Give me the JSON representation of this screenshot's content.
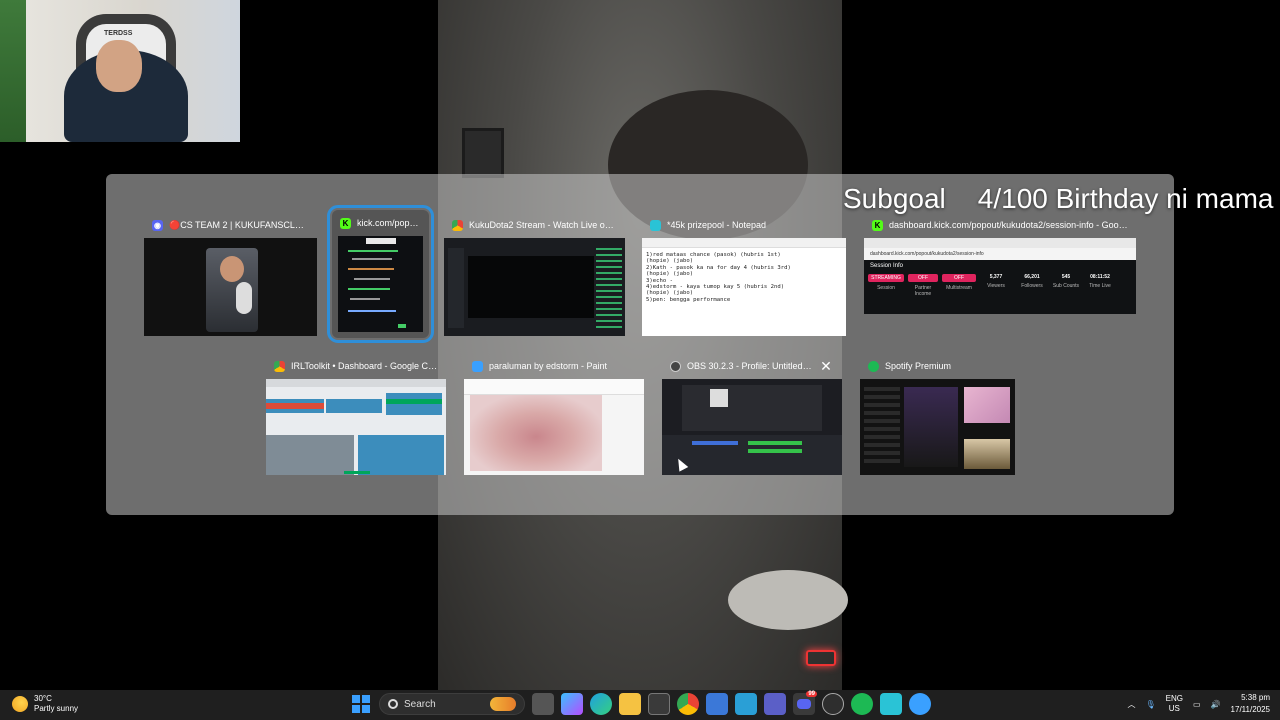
{
  "overlay": {
    "subgoal_label": "Subgoal",
    "subgoal_value": "4/100 Birthday ni mama",
    "chair_brand": "TERDSS"
  },
  "windows": [
    {
      "id": "discord",
      "title": "🔴CS TEAM 2 | KUKUFANSCLUB - Disco...",
      "icon": "discord-icon",
      "color": "#5865f2"
    },
    {
      "id": "kick-popout",
      "title": "kick.com/popo...",
      "icon": "kick-icon",
      "color": "#53fc18",
      "selected": true
    },
    {
      "id": "kukudota-stream",
      "title": "KukuDota2 Stream - Watch Live on Kick...",
      "icon": "chrome-icon",
      "color": "#4285f4"
    },
    {
      "id": "notepad",
      "title": "*45k prizepool - Notepad",
      "icon": "notepad-icon",
      "color": "#2ac3d6"
    },
    {
      "id": "session-info",
      "title": "dashboard.kick.com/popout/kukudota2/session-info - Google C...",
      "icon": "kick-icon",
      "color": "#53fc18"
    },
    {
      "id": "irltoolkit",
      "title": "IRLToolkit • Dashboard - Google Chrome",
      "icon": "chrome-icon",
      "color": "#4285f4"
    },
    {
      "id": "paint",
      "title": "paraluman by edstorm - Paint",
      "icon": "paint-icon",
      "color": "#3aa0ff"
    },
    {
      "id": "obs",
      "title": "OBS 30.2.3 - Profile: Untitled - Sce...",
      "icon": "obs-icon",
      "color": "#444"
    },
    {
      "id": "spotify",
      "title": "Spotify Premium",
      "icon": "spotify-icon",
      "color": "#1db954"
    }
  ],
  "notepad_lines": [
    "1)red mataas chance (pasok) (hubris 1st)",
    "(hopie) (jabo)",
    "2)Kath - pasok ka na for day 4 (hubris 3rd)",
    "(hopie) (jabo)",
    "3)echo -",
    "4)edstorm - kaya tumop kay 5 (hubris 2nd)",
    "(hopie) (jabo)",
    "5)pen: bengga performance"
  ],
  "session_info": {
    "url": "dashboard.kick.com/popout/kukudota2/session-info",
    "heading": "Session Info",
    "stats": [
      {
        "badge": "STREAMING",
        "label": "Session"
      },
      {
        "badge": "OFF",
        "label": "Partner Income"
      },
      {
        "badge": "OFF",
        "label": "Multistream"
      },
      {
        "value": "5,377",
        "label": "Viewers"
      },
      {
        "value": "66,201",
        "label": "Followers"
      },
      {
        "value": "545",
        "label": "Sub Counts"
      },
      {
        "value": "08:11:52",
        "label": "Time Live"
      }
    ]
  },
  "taskbar": {
    "weather_temp": "30°C",
    "weather_desc": "Partly sunny",
    "search_placeholder": "Search",
    "lang_1": "ENG",
    "lang_2": "US",
    "time": "5:38 pm",
    "date": "17/11/2025",
    "discord_badge": "99"
  }
}
